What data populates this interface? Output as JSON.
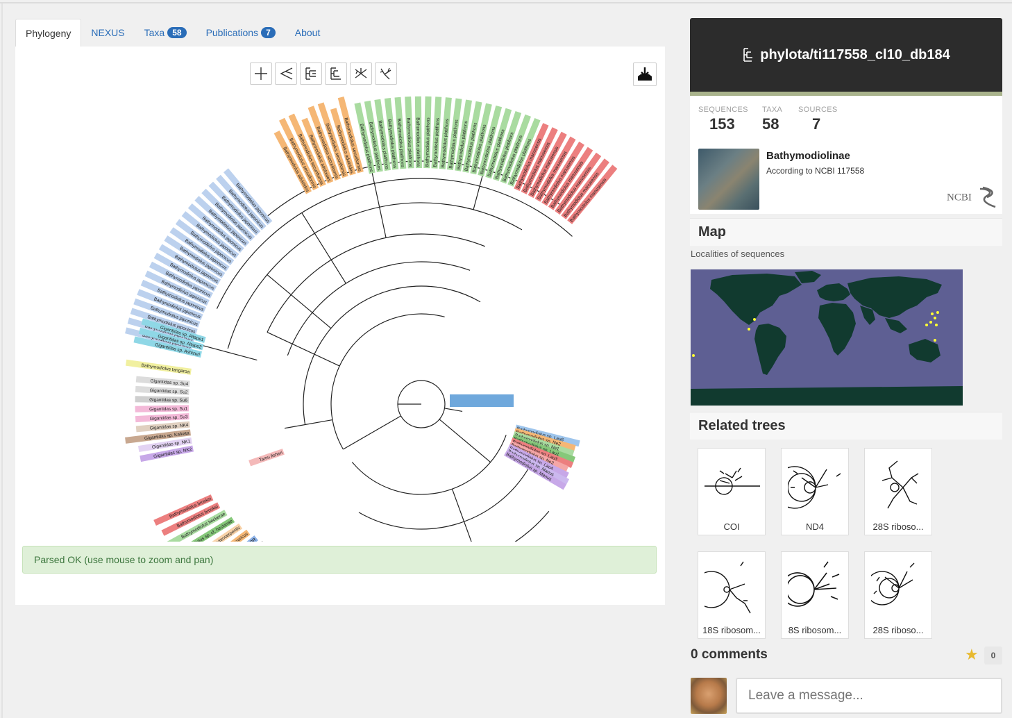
{
  "tabs": [
    {
      "label": "Phylogeny",
      "active": true
    },
    {
      "label": "NEXUS"
    },
    {
      "label": "Taxa",
      "badge": "58"
    },
    {
      "label": "Publications",
      "badge": "7"
    },
    {
      "label": "About"
    }
  ],
  "toolbar": {
    "icons": [
      "rectangular-tree-icon",
      "slanted-tree-icon",
      "phylogram-icon",
      "cladogram-icon",
      "radial-tree-icon",
      "unrooted-tree-icon"
    ],
    "download_icon": "download-icon"
  },
  "status": "Parsed OK (use mouse to zoom and pan)",
  "tree": {
    "title": "phylota/ti117558_cl10_db184",
    "stats": [
      {
        "label": "SEQUENCES",
        "value": "153"
      },
      {
        "label": "TAXA",
        "value": "58"
      },
      {
        "label": "SOURCES",
        "value": "7"
      }
    ],
    "taxon": "Bathymodiolinae",
    "taxon_source": "According to NCBI 117558",
    "ncbi_label": "NCBI"
  },
  "map": {
    "title": "Map",
    "subtitle": "Localities of sequences"
  },
  "related": {
    "title": "Related trees",
    "items": [
      "COI",
      "ND4",
      "28S riboso...",
      "18S ribosom...",
      "8S ribosom...",
      "28S riboso..."
    ]
  },
  "comments": {
    "label": "0 comments",
    "count": "0",
    "placeholder": "Leave a message..."
  },
  "colors": {
    "accent": "#2a6db8",
    "header_bg": "#2c2c2c",
    "status_bg": "#dff0d8",
    "map_ocean": "#5e5f93",
    "map_land": "#113a2f",
    "map_points": "#ffff33"
  },
  "leaf_labels": {
    "orange": [
      "Bathymodiolus aduloides",
      "Bathymodiolus securiformis",
      "Bathymodiolus securiformis"
    ],
    "green": [
      "Bathymodiolus platifrons",
      "Bathymodiolus platifrons",
      "Bathymodiolus platifrons"
    ],
    "red": [
      "Bathymodiolus manusensis",
      "Bathymodiolus manusensis"
    ],
    "blue": [
      "Bathymodiolus japonicus",
      "Bathymodiolus japonicus",
      "Bathymodiolus japonicus"
    ],
    "cyan": [
      "Gigantidas sp. Aitape1",
      "Gigantidas sp. Aitape2",
      "Gigantidas sp. Ashizuri"
    ],
    "misc": [
      "Bathymodiolus tangaroa",
      "Gigantidas sp. Su4",
      "Gigantidas sp. Su2",
      "Gigantidas sp. Su6",
      "Gigantidas sp. Su1",
      "Gigantidas sp. Su3",
      "Gigantidas sp. NK4",
      "Gigantidas sp. Kaikata",
      "Gigantidas sp. NK1",
      "Gigantidas sp. NK2",
      "Tamu fisheri"
    ],
    "lower": [
      "Bathymodiolus brooksi",
      "Bathymodiolus brooksi",
      "Bathymodiolus heckerae",
      "Bathymodiolus sp. cf. heckerae",
      "Bathymodiolus puteoserpentis",
      "Bathymodiolus azoricus",
      "Bathymodiolus sp. EPR",
      "Bathymodiolus brevior"
    ],
    "inner": [
      "Bathymodiolus sp. Lau6",
      "Bathymodiolus sp. Ne2",
      "Bathymodiolus sp. Ne1",
      "Bathymodiolus sp. Lau1",
      "Bathymodiolus sp. Lau3",
      "Bathymodiolus sp. Ne3",
      "Bathymodiolus sp. Lau4",
      "Bathymodiolus sp. Manus",
      "Bathymodiolus sp. Manus"
    ]
  }
}
